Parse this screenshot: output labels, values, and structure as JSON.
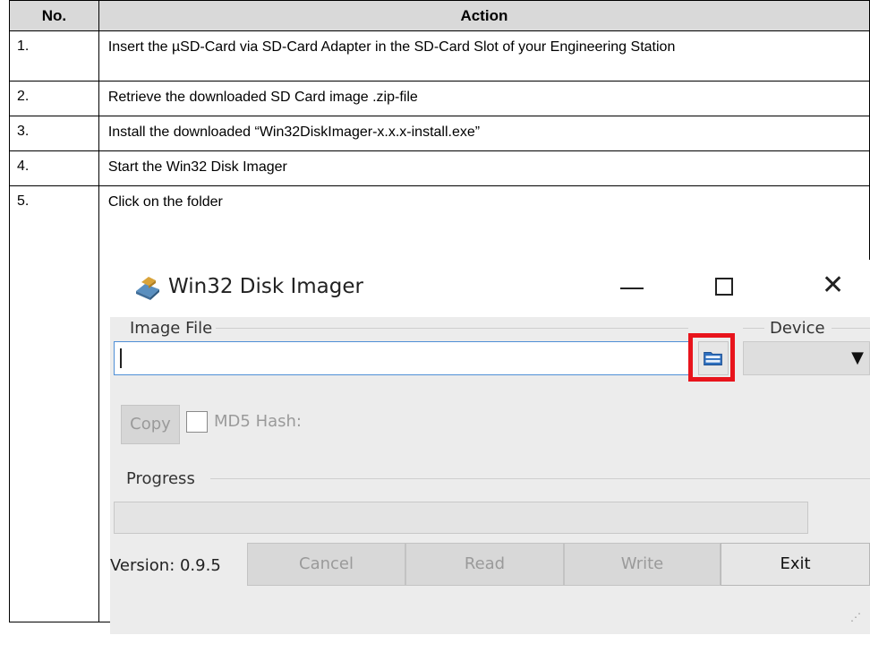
{
  "table": {
    "headers": {
      "no": "No.",
      "action": "Action"
    },
    "rows": [
      {
        "no": "1.",
        "action": "Insert the µSD-Card via SD-Card Adapter in the SD-Card Slot of your Engineering Station"
      },
      {
        "no": "2.",
        "action": "Retrieve the downloaded SD Card image .zip-file"
      },
      {
        "no": "3.",
        "action": "Install the downloaded “Win32DiskImager-x.x.x-install.exe”"
      },
      {
        "no": "4.",
        "action": "Start the Win32 Disk Imager"
      },
      {
        "no": "5.",
        "action": "Click on the folder"
      }
    ]
  },
  "app": {
    "title": "Win32 Disk Imager",
    "image_file_label": "Image File",
    "image_file_value": "",
    "device_label": "Device",
    "device_value": "",
    "copy_button": "Copy",
    "md5_label": "MD5 Hash:",
    "md5_checked": false,
    "progress_label": "Progress",
    "progress_value": 0,
    "version": "Version: 0.9.5",
    "buttons": {
      "cancel": "Cancel",
      "read": "Read",
      "write": "Write",
      "exit": "Exit"
    },
    "icons": {
      "app": "disk-imager-icon",
      "folder": "folder-icon",
      "minimize": "minimize-icon",
      "maximize": "maximize-icon",
      "close": "close-icon",
      "dropdown": "chevron-down-icon",
      "grip": "resize-grip-icon"
    },
    "highlight_color": "#e8141c"
  }
}
